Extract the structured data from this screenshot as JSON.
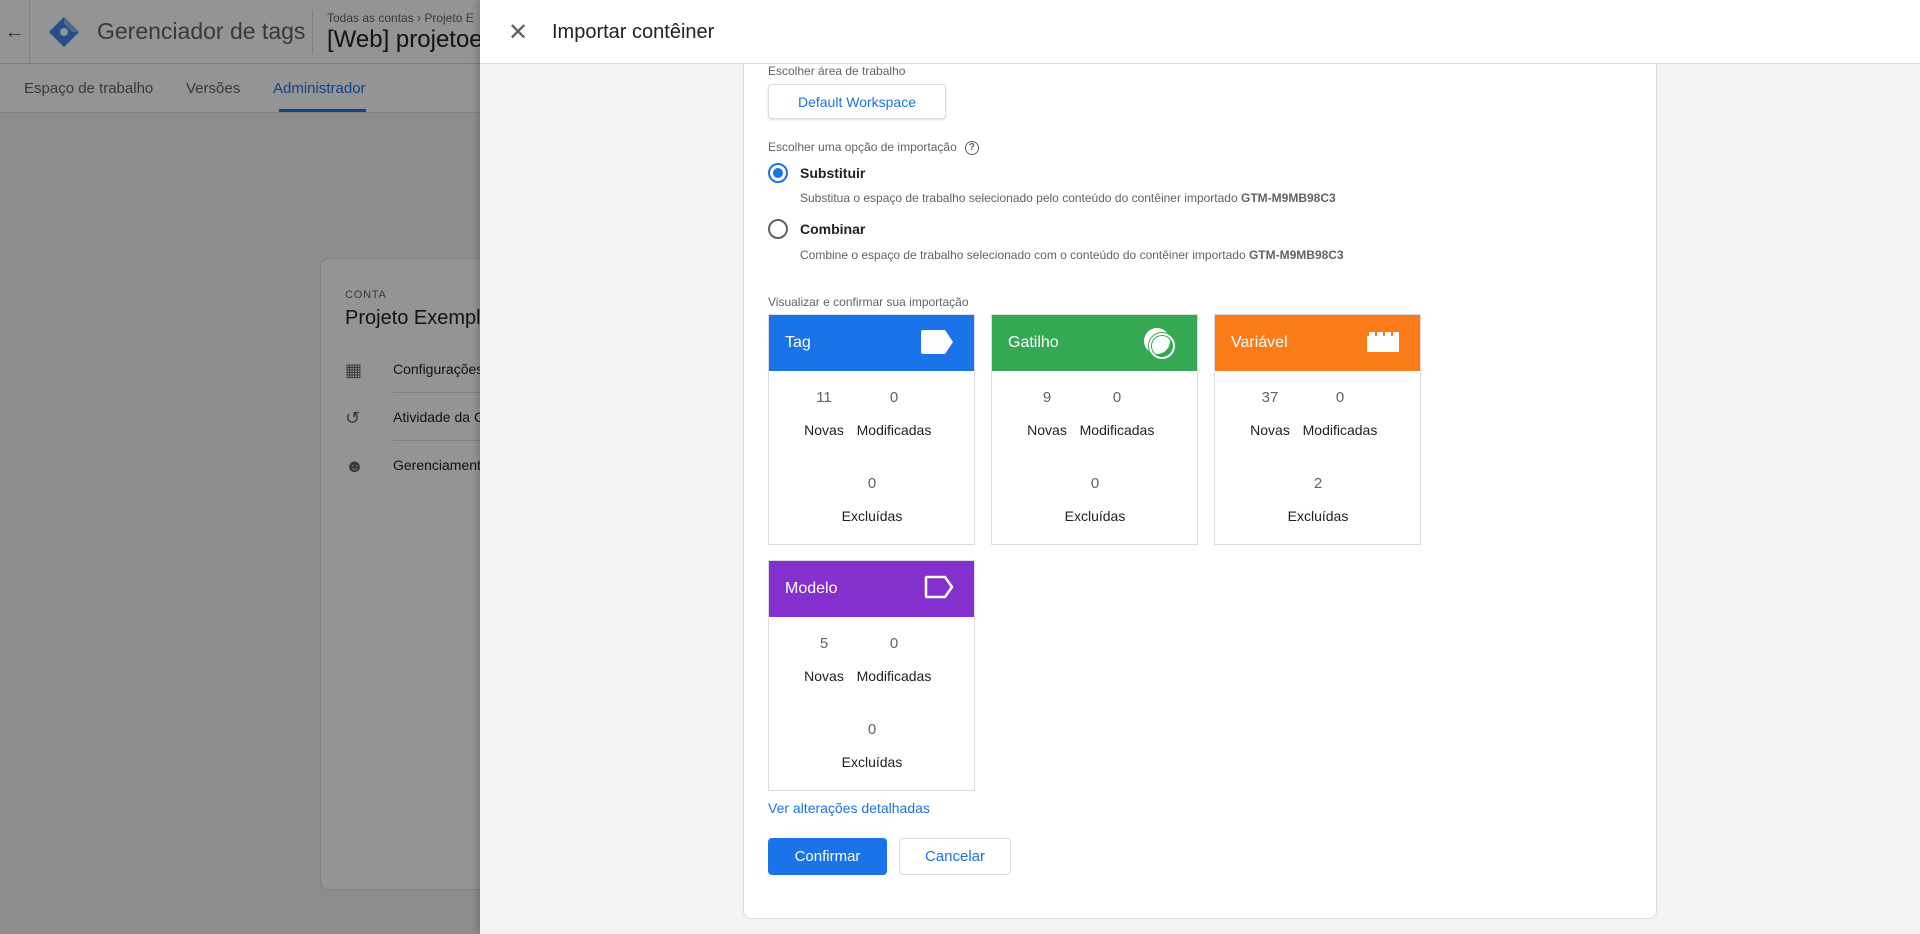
{
  "app": {
    "title": "Gerenciador de tags",
    "breadcrumb": "Todas as contas  ›  Projeto E",
    "container_name": "[Web] projetoe:",
    "back_icon": "arrow-back-icon",
    "logo_icon": "gtm-diamond-icon"
  },
  "tabs": [
    {
      "label": "Espaço de trabalho"
    },
    {
      "label": "Versões"
    },
    {
      "label": "Administrador"
    }
  ],
  "account_card": {
    "label": "CONTA",
    "name": "Projeto Exempl",
    "items": [
      {
        "label": "Configurações",
        "icon": "building-icon"
      },
      {
        "label": "Atividade da C",
        "icon": "history-icon"
      },
      {
        "label": "Gerenciament",
        "icon": "people-icon"
      }
    ]
  },
  "dialog": {
    "title": "Importar contêiner",
    "close_icon": "close-icon",
    "workspace_label": "Escolher área de trabalho",
    "workspace_button": "Default Workspace",
    "import_option_label": "Escolher uma opção de importação",
    "options": [
      {
        "label": "Substituir",
        "selected": true,
        "desc": "Substitua o espaço de trabalho selecionado pelo conteúdo do contêiner importado",
        "container_id": "GTM-M9MB98C3"
      },
      {
        "label": "Combinar",
        "selected": false,
        "desc": "Combine o espaço de trabalho selecionado com o conteúdo do contêiner importado",
        "container_id": "GTM-M9MB98C3"
      }
    ],
    "preview_label": "Visualizar e confirmar sua importação",
    "cards": [
      {
        "title": "Tag",
        "color": "#1a73e8",
        "icon": "tag-icon",
        "new": "11",
        "modified": "0",
        "deleted": "0"
      },
      {
        "title": "Gatilho",
        "color": "#34a853",
        "icon": "trigger-icon",
        "new": "9",
        "modified": "0",
        "deleted": "0"
      },
      {
        "title": "Variável",
        "color": "#fa7b17",
        "icon": "variable-icon",
        "new": "37",
        "modified": "0",
        "deleted": "2"
      },
      {
        "title": "Modelo",
        "color": "#8430ce",
        "icon": "template-icon",
        "new": "5",
        "modified": "0",
        "deleted": "0"
      }
    ],
    "labels": {
      "new": "Novas",
      "modified": "Modificadas",
      "deleted": "Excluídas"
    },
    "details_link": "Ver alterações detalhadas",
    "confirm_button": "Confirmar",
    "cancel_button": "Cancelar"
  }
}
